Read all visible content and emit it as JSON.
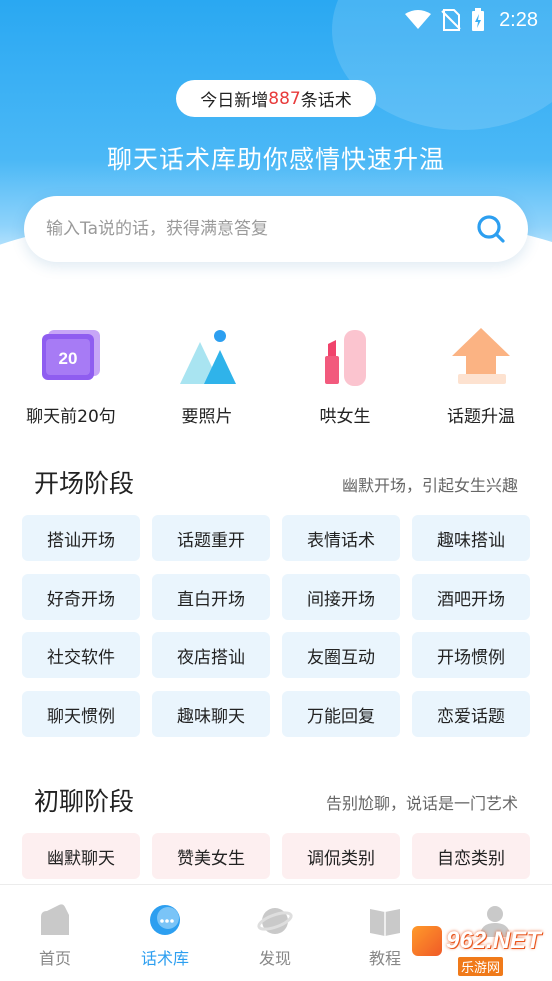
{
  "status": {
    "time": "2:28"
  },
  "banner": {
    "prefix": "今日新增",
    "count": "887",
    "suffix": "条话术"
  },
  "headline": "聊天话术库助你感情快速升温",
  "search": {
    "placeholder": "输入Ta说的话，获得满意答复"
  },
  "quick_links": [
    {
      "label": "聊天前20句",
      "icon": "calendar-20-icon",
      "badge": "20"
    },
    {
      "label": "要照片",
      "icon": "mountain-photo-icon"
    },
    {
      "label": "哄女生",
      "icon": "lipstick-icon"
    },
    {
      "label": "话题升温",
      "icon": "arrow-up-icon"
    }
  ],
  "sections": [
    {
      "title": "开场阶段",
      "subtitle": "幽默开场，引起女生兴趣",
      "chips": [
        "搭讪开场",
        "话题重开",
        "表情话术",
        "趣味搭讪",
        "好奇开场",
        "直白开场",
        "间接开场",
        "酒吧开场",
        "社交软件",
        "夜店搭讪",
        "友圈互动",
        "开场惯例",
        "聊天惯例",
        "趣味聊天",
        "万能回复",
        "恋爱话题"
      ]
    },
    {
      "title": "初聊阶段",
      "subtitle": "告别尬聊，说话是一门艺术",
      "chips": [
        "幽默聊天",
        "赞美女生",
        "调侃类别",
        "自恋类别"
      ]
    }
  ],
  "tabs": [
    {
      "label": "首页",
      "icon": "home-icon"
    },
    {
      "label": "话术库",
      "icon": "chat-bubble-icon",
      "active": true
    },
    {
      "label": "发现",
      "icon": "planet-icon"
    },
    {
      "label": "教程",
      "icon": "book-icon"
    },
    {
      "label": "",
      "icon": "profile-icon"
    }
  ],
  "watermark": {
    "brand": "962.NET",
    "sub": "乐游网"
  },
  "colors": {
    "accent": "#2d9ff0",
    "highlight": "#e83b3b",
    "chip_blue": "#eaf5fd",
    "chip_pink": "#fdeff0"
  }
}
